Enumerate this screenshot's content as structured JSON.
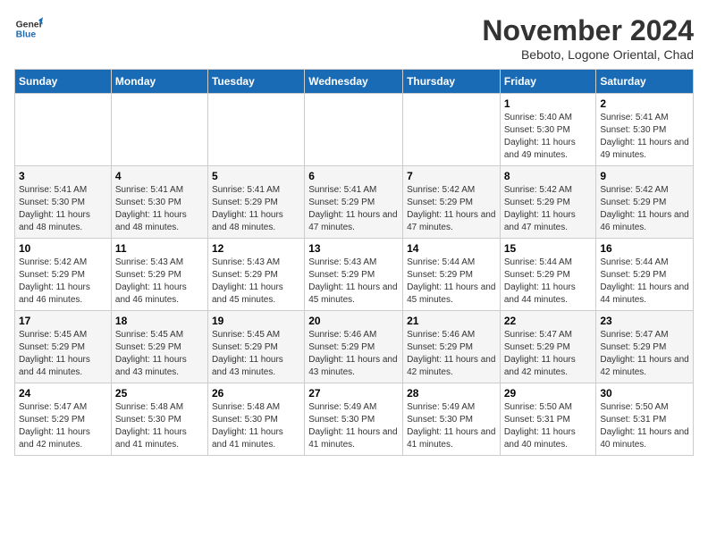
{
  "logo": {
    "line1": "General",
    "line2": "Blue"
  },
  "title": "November 2024",
  "location": "Beboto, Logone Oriental, Chad",
  "days_of_week": [
    "Sunday",
    "Monday",
    "Tuesday",
    "Wednesday",
    "Thursday",
    "Friday",
    "Saturday"
  ],
  "weeks": [
    [
      {
        "num": "",
        "info": ""
      },
      {
        "num": "",
        "info": ""
      },
      {
        "num": "",
        "info": ""
      },
      {
        "num": "",
        "info": ""
      },
      {
        "num": "",
        "info": ""
      },
      {
        "num": "1",
        "info": "Sunrise: 5:40 AM\nSunset: 5:30 PM\nDaylight: 11 hours and 49 minutes."
      },
      {
        "num": "2",
        "info": "Sunrise: 5:41 AM\nSunset: 5:30 PM\nDaylight: 11 hours and 49 minutes."
      }
    ],
    [
      {
        "num": "3",
        "info": "Sunrise: 5:41 AM\nSunset: 5:30 PM\nDaylight: 11 hours and 48 minutes."
      },
      {
        "num": "4",
        "info": "Sunrise: 5:41 AM\nSunset: 5:30 PM\nDaylight: 11 hours and 48 minutes."
      },
      {
        "num": "5",
        "info": "Sunrise: 5:41 AM\nSunset: 5:29 PM\nDaylight: 11 hours and 48 minutes."
      },
      {
        "num": "6",
        "info": "Sunrise: 5:41 AM\nSunset: 5:29 PM\nDaylight: 11 hours and 47 minutes."
      },
      {
        "num": "7",
        "info": "Sunrise: 5:42 AM\nSunset: 5:29 PM\nDaylight: 11 hours and 47 minutes."
      },
      {
        "num": "8",
        "info": "Sunrise: 5:42 AM\nSunset: 5:29 PM\nDaylight: 11 hours and 47 minutes."
      },
      {
        "num": "9",
        "info": "Sunrise: 5:42 AM\nSunset: 5:29 PM\nDaylight: 11 hours and 46 minutes."
      }
    ],
    [
      {
        "num": "10",
        "info": "Sunrise: 5:42 AM\nSunset: 5:29 PM\nDaylight: 11 hours and 46 minutes."
      },
      {
        "num": "11",
        "info": "Sunrise: 5:43 AM\nSunset: 5:29 PM\nDaylight: 11 hours and 46 minutes."
      },
      {
        "num": "12",
        "info": "Sunrise: 5:43 AM\nSunset: 5:29 PM\nDaylight: 11 hours and 45 minutes."
      },
      {
        "num": "13",
        "info": "Sunrise: 5:43 AM\nSunset: 5:29 PM\nDaylight: 11 hours and 45 minutes."
      },
      {
        "num": "14",
        "info": "Sunrise: 5:44 AM\nSunset: 5:29 PM\nDaylight: 11 hours and 45 minutes."
      },
      {
        "num": "15",
        "info": "Sunrise: 5:44 AM\nSunset: 5:29 PM\nDaylight: 11 hours and 44 minutes."
      },
      {
        "num": "16",
        "info": "Sunrise: 5:44 AM\nSunset: 5:29 PM\nDaylight: 11 hours and 44 minutes."
      }
    ],
    [
      {
        "num": "17",
        "info": "Sunrise: 5:45 AM\nSunset: 5:29 PM\nDaylight: 11 hours and 44 minutes."
      },
      {
        "num": "18",
        "info": "Sunrise: 5:45 AM\nSunset: 5:29 PM\nDaylight: 11 hours and 43 minutes."
      },
      {
        "num": "19",
        "info": "Sunrise: 5:45 AM\nSunset: 5:29 PM\nDaylight: 11 hours and 43 minutes."
      },
      {
        "num": "20",
        "info": "Sunrise: 5:46 AM\nSunset: 5:29 PM\nDaylight: 11 hours and 43 minutes."
      },
      {
        "num": "21",
        "info": "Sunrise: 5:46 AM\nSunset: 5:29 PM\nDaylight: 11 hours and 42 minutes."
      },
      {
        "num": "22",
        "info": "Sunrise: 5:47 AM\nSunset: 5:29 PM\nDaylight: 11 hours and 42 minutes."
      },
      {
        "num": "23",
        "info": "Sunrise: 5:47 AM\nSunset: 5:29 PM\nDaylight: 11 hours and 42 minutes."
      }
    ],
    [
      {
        "num": "24",
        "info": "Sunrise: 5:47 AM\nSunset: 5:29 PM\nDaylight: 11 hours and 42 minutes."
      },
      {
        "num": "25",
        "info": "Sunrise: 5:48 AM\nSunset: 5:30 PM\nDaylight: 11 hours and 41 minutes."
      },
      {
        "num": "26",
        "info": "Sunrise: 5:48 AM\nSunset: 5:30 PM\nDaylight: 11 hours and 41 minutes."
      },
      {
        "num": "27",
        "info": "Sunrise: 5:49 AM\nSunset: 5:30 PM\nDaylight: 11 hours and 41 minutes."
      },
      {
        "num": "28",
        "info": "Sunrise: 5:49 AM\nSunset: 5:30 PM\nDaylight: 11 hours and 41 minutes."
      },
      {
        "num": "29",
        "info": "Sunrise: 5:50 AM\nSunset: 5:31 PM\nDaylight: 11 hours and 40 minutes."
      },
      {
        "num": "30",
        "info": "Sunrise: 5:50 AM\nSunset: 5:31 PM\nDaylight: 11 hours and 40 minutes."
      }
    ]
  ]
}
